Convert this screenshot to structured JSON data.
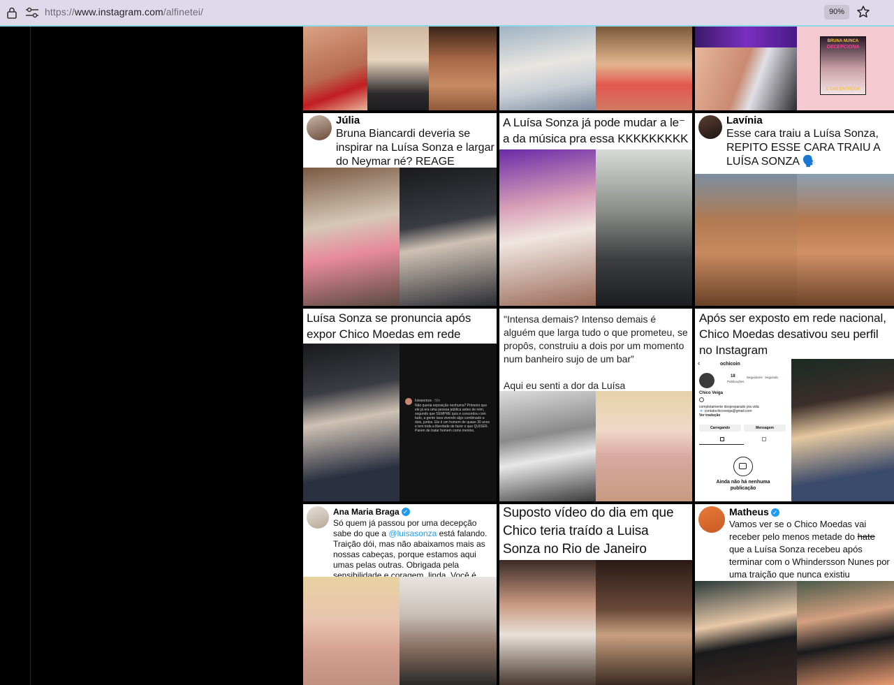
{
  "browser": {
    "url_scheme": "https://",
    "url_host": "www.instagram.com",
    "url_path": "/alfinetei/",
    "zoom": "90%"
  },
  "colors": {
    "urlbar": "#dfdaea",
    "accent_line": "#8ad7e6",
    "verified": "#1d9bf0",
    "page_bg": "#000000"
  },
  "icons": [
    "lock-icon",
    "tune-icon",
    "star-icon",
    "verified-icon",
    "camera-icon"
  ],
  "posts": {
    "p1": {},
    "p2": {},
    "p3": {
      "poster_line1": "BRUNA NUNCA",
      "poster_line2": "DECEPCIONA",
      "poster_line3": "E LHE ENTREGA"
    },
    "p4": {
      "name": "Júlia",
      "text": "Bruna Biancardi deveria se inspirar na Luísa Sonza e largar do Neymar né? REAGE MULHER"
    },
    "p5": {
      "caption": "A Luísa Sonza já pode mudar a le⁻ a da música pra essa KKKKKKKKK"
    },
    "p6": {
      "name": "Lavínia",
      "text": "Esse cara traiu a Luísa Sonza, REPITO ESSE CARA TRAIU A LUÍSA SONZA 🗣️"
    },
    "p7": {
      "caption": "Luísa Sonza se pronuncia após expor Chico Moedas em rede nacional:",
      "dm_user": "luisasonza",
      "dm_time": "58s",
      "dm_text": "Não queria exposição nenhuma? Primeiro que ele já era uma pessoa pública antes de mim, segundo que SEMPRE quis e concordou com tudo, a gente tava vivendo algo combinado a dois, juntos. Ele é um homem de quase 30 anos e tem toda a liberdade de fazer o que QUISER. Parem de tratar homem como menino."
    },
    "p8": {
      "caption": "\"Intensa demais? Intenso demais é alguém que larga tudo o que prometeu, se propôs, construiu a dois por um momento num banheiro sujo de um bar”",
      "caption2": "Aqui eu senti a dor da Luísa"
    },
    "p9": {
      "caption": "Após ser exposto em rede nacional, Chico Moedas desativou seu perfil no Instagram",
      "profile": {
        "username": "ochicoin",
        "posts_count": "18",
        "posts_label": "Publicações",
        "followers_label": "Seguidores",
        "following_label": "Seguindo",
        "name": "Chico Veiga",
        "bio": "completamente despreparado pra vida",
        "email": "📧 contatochicoveiga@gmail.com",
        "translate": "Ver tradução",
        "btn_loading": "Carregando",
        "btn_message": "Mensagem",
        "empty": "Ainda não há nenhuma publicação"
      }
    },
    "p10": {
      "name": "Ana Maria Braga",
      "text_before": "Só quem já passou por uma decepção sabe do que a ",
      "mention": "@luisasonza",
      "text_after": " está falando. Traição dói, mas não abaixamos mais as nossas cabeças, porque estamos aqui umas pelas outras. Obrigada pela sensibilidade e coragem, linda. Você é uma fortaleza.❤️"
    },
    "p11": {
      "caption": "Suposto vídeo do dia em que Chico teria traído a Luisa Sonza no Rio de Janeiro"
    },
    "p12": {
      "name": "Matheus",
      "text_before": "Vamos ver se o Chico Moedas vai receber pelo menos metade do ",
      "struck": "hate",
      "text_after": " que a Luísa Sonza recebeu após terminar com o Whindersson Nunes por uma traição que nunca existiu"
    }
  }
}
